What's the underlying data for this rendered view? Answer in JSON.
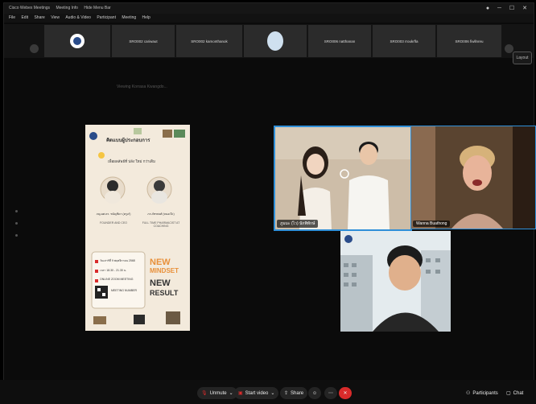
{
  "titlebar": {
    "app": "Cisco Webex Meetings",
    "meeting": "Meeting Info",
    "view": "Hide Menu Bar"
  },
  "menu": [
    "File",
    "Edit",
    "Share",
    "View",
    "Audio & Video",
    "Participant",
    "Meeting",
    "Help"
  ],
  "strip": {
    "tiles": [
      "SRO002 cariwaut",
      "SRO002 kamonthanok",
      "SRO006 natthanan",
      "SRO003 rroukrfla",
      "SRO006 fiwllnreu"
    ],
    "layout": "Layout"
  },
  "caption": "Viewing Korrasa Kwangdo...",
  "poster": {
    "title": "คิดแบบผู้ประกอบการ",
    "subtitle": "เพื่อผลลัพธ์ที่ ปลัง ใหม่ กว่าเดิม",
    "speaker_left": "ภญ.ผศ.ดร. ชนัญชิดา (ครูเก๋)",
    "speaker_right": "ภก.ภัทรพงศ์ (หมอเป๊ะ)",
    "tagline_left": "FOUNDER AND CEO",
    "tagline_right": "FULL TIME PHARMACIST AT COACHING",
    "date": "วันเสาร์ที่ 9 พฤศจิกายน 2568",
    "time": "เวลา 18.30 - 21.30 น.",
    "venue": "ONLINE ZOOM MEETING",
    "meeting_label": "MEETING NUMBER",
    "headline1": "NEW",
    "headline2": "MINDSET",
    "headline3": "NEW",
    "headline4": "RESULT"
  },
  "videos": {
    "couple_name": "ภูมมะ (ไว) นักพิทักษ์",
    "woman_name": "Wanna Buathong"
  },
  "toolbar": {
    "unmute": "Unmute",
    "start_video": "Start video",
    "share": "Share",
    "participants": "Participants",
    "chat": "Chat"
  },
  "colors": {
    "accent_red": "#d92b2b",
    "active_border": "#2f8fd8",
    "poster_bg": "#f3eadc"
  }
}
